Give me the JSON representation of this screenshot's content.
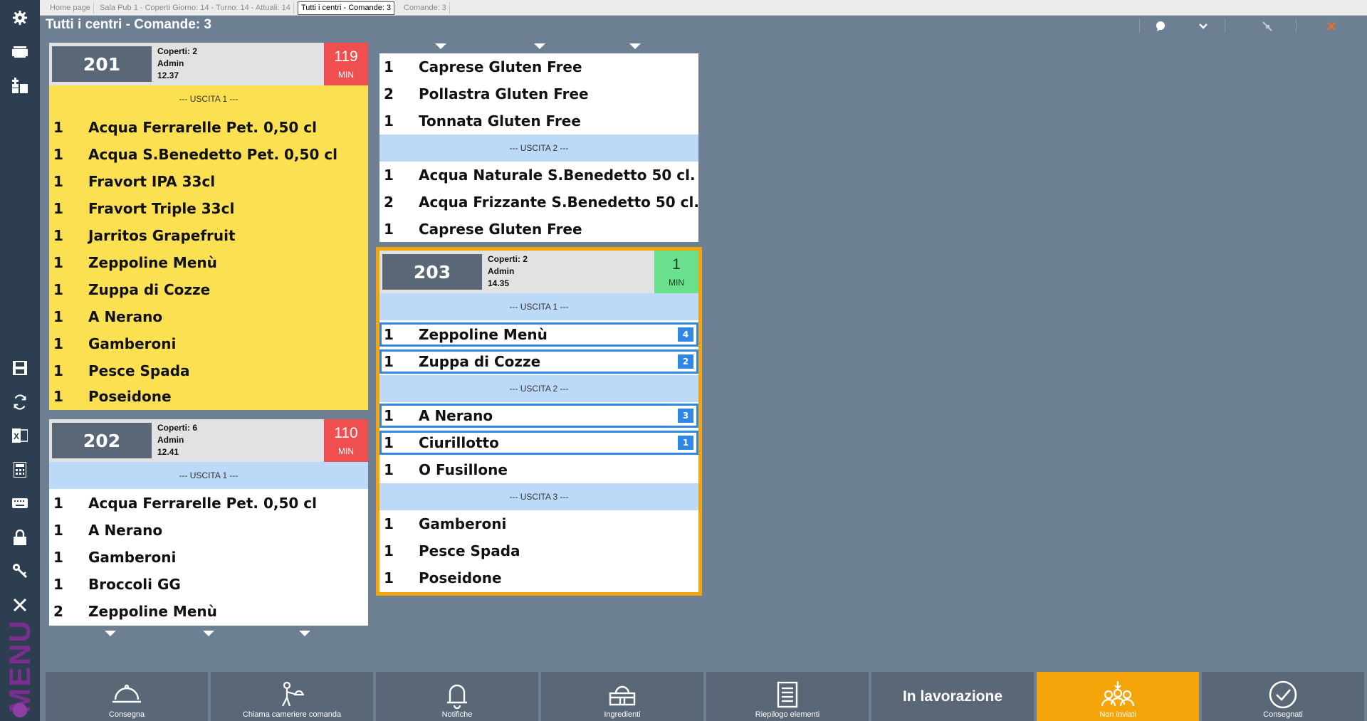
{
  "sidebar": {
    "items": [
      "gear-icon",
      "screen-icon",
      "dashboard-add-icon",
      "save-icon",
      "refresh-icon",
      "excel-icon",
      "calculator-icon",
      "keyboard-icon",
      "lock-icon",
      "key-icon",
      "close-icon"
    ],
    "menu_label": "MENU"
  },
  "tabs": [
    {
      "label": "Home page"
    },
    {
      "label": "Sala Pub 1 - Coperti Giorno: 14 - Turno: 14 - Attuali: 14"
    },
    {
      "label": "Tutti i centri - Comande: 3",
      "active": true
    },
    {
      "label": "Comande: 3"
    }
  ],
  "page_title": "Tutti i centri - Comande: 3",
  "tickets": [
    {
      "number": "201",
      "coperti": "Coperti: 2",
      "user": "Admin",
      "time": "12.37",
      "minutes": "119",
      "min_label": "MIN",
      "min_color": "#f04f4f",
      "sections": [
        {
          "label": "--- USCITA 1 ---",
          "items": [
            {
              "qty": "1",
              "name": "Acqua Ferrarelle Pet. 0,50 cl"
            },
            {
              "qty": "1",
              "name": "Acqua S.Benedetto Pet. 0,50 cl"
            },
            {
              "qty": "1",
              "name": "Fravort IPA 33cl"
            },
            {
              "qty": "1",
              "name": "Fravort Triple 33cl"
            },
            {
              "qty": "1",
              "name": "Jarritos Grapefruit"
            },
            {
              "qty": "1",
              "name": "Zeppoline Menù"
            },
            {
              "qty": "1",
              "name": "Zuppa di Cozze"
            },
            {
              "qty": "1",
              "name": "A Nerano"
            },
            {
              "qty": "1",
              "name": "Gamberoni"
            },
            {
              "qty": "1",
              "name": "Pesce Spada"
            },
            {
              "qty": "1",
              "name": "Poseidone"
            }
          ]
        }
      ]
    },
    {
      "number": "202",
      "coperti": "Coperti: 6",
      "user": "Admin",
      "time": "12.41",
      "minutes": "110",
      "min_label": "MIN",
      "min_color": "#f04f4f",
      "sections": [
        {
          "label": "--- USCITA 1 ---",
          "items": [
            {
              "qty": "1",
              "name": "Acqua Ferrarelle Pet. 0,50 cl"
            },
            {
              "qty": "1",
              "name": "A Nerano"
            },
            {
              "qty": "1",
              "name": "Gamberoni"
            },
            {
              "qty": "1",
              "name": "Broccoli GG"
            },
            {
              "qty": "2",
              "name": "Zeppoline Menù"
            }
          ]
        }
      ]
    },
    {
      "continued_items": [
        {
          "qty": "1",
          "name": "Caprese Gluten Free"
        },
        {
          "qty": "2",
          "name": "Pollastra Gluten Free"
        },
        {
          "qty": "1",
          "name": "Tonnata Gluten Free"
        }
      ],
      "sections": [
        {
          "label": "--- USCITA 2 ---",
          "items": [
            {
              "qty": "1",
              "name": "Acqua Naturale S.Benedetto 50 cl."
            },
            {
              "qty": "2",
              "name": "Acqua Frizzante S.Benedetto 50 cl."
            },
            {
              "qty": "1",
              "name": "Caprese Gluten Free"
            }
          ]
        }
      ]
    },
    {
      "number": "203",
      "coperti": "Coperti: 2",
      "user": "Admin",
      "time": "14.35",
      "minutes": "1",
      "min_label": "MIN",
      "min_color": "#69e08c",
      "sections": [
        {
          "label": "--- USCITA 1 ---",
          "items": [
            {
              "qty": "1",
              "name": "Zeppoline Menù",
              "badge": "4"
            },
            {
              "qty": "1",
              "name": "Zuppa di Cozze",
              "badge": "2"
            }
          ]
        },
        {
          "label": "--- USCITA 2 ---",
          "items": [
            {
              "qty": "1",
              "name": "A Nerano",
              "badge": "3"
            },
            {
              "qty": "1",
              "name": "Ciurillotto",
              "badge": "1"
            },
            {
              "qty": "1",
              "name": "O Fusillone"
            }
          ]
        },
        {
          "label": "--- USCITA 3 ---",
          "items": [
            {
              "qty": "1",
              "name": "Gamberoni"
            },
            {
              "qty": "1",
              "name": "Pesce Spada"
            },
            {
              "qty": "1",
              "name": "Poseidone"
            }
          ]
        }
      ]
    }
  ],
  "bottom_buttons": [
    {
      "label": "Consegna",
      "icon": "bell-tray-icon"
    },
    {
      "label": "Chiama cameriere comanda",
      "icon": "waiter-icon"
    },
    {
      "label": "Notifiche",
      "icon": "bell-icon"
    },
    {
      "label": "Ingredienti",
      "icon": "basket-icon"
    },
    {
      "label": "Riepilogo elementi",
      "icon": "list-icon"
    },
    {
      "label": "In lavorazione",
      "icon": ""
    },
    {
      "label": "Non inviati",
      "icon": "people-icon",
      "color": "#f5a50a"
    },
    {
      "label": "Consegnati",
      "icon": "check-circle-icon"
    }
  ],
  "colors": {
    "background": "#6d7f92",
    "sidebar": "#2c3e50",
    "ticket_yellow": "#fbe052",
    "uscita_bar": "#bcd9f7",
    "selected_ticket_border": "#f5a50a",
    "badge_blue": "#2f88e6"
  }
}
